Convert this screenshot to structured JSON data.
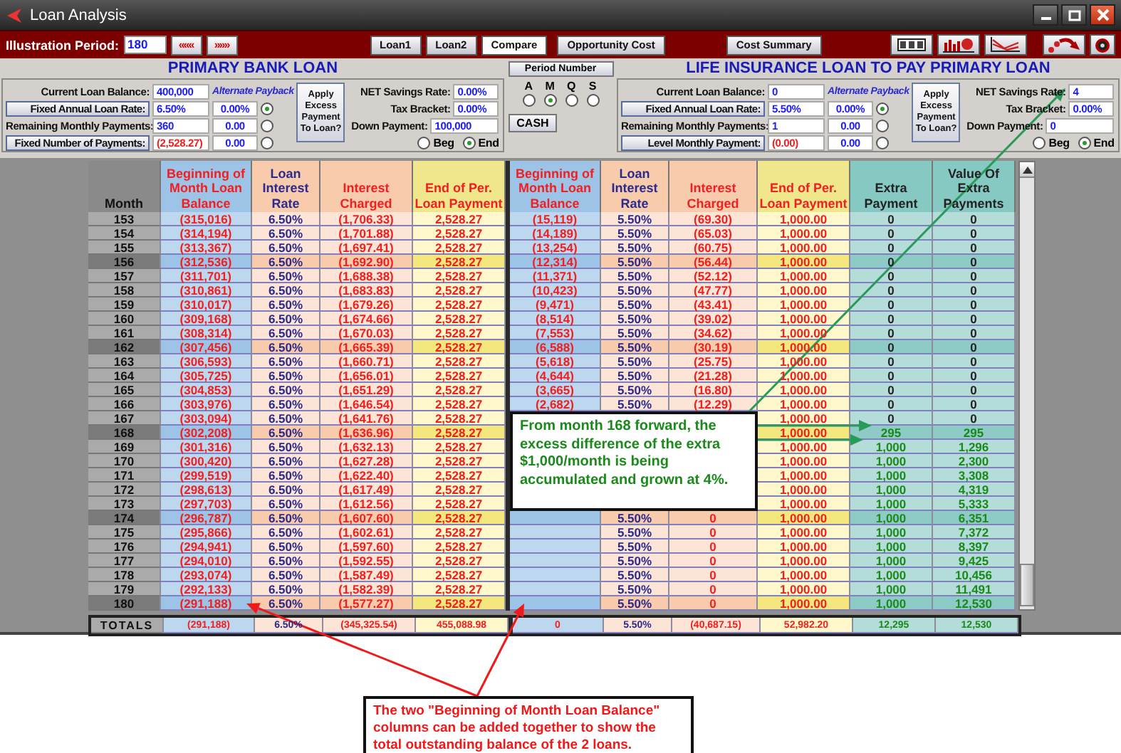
{
  "window": {
    "title": "Loan Analysis"
  },
  "toolbar": {
    "period_label": "Illustration Period:",
    "period_value": "180",
    "nav_buttons": [
      "«««",
      "»»»"
    ],
    "buttons": [
      {
        "label": "Loan1",
        "selected": false
      },
      {
        "label": "Loan2",
        "selected": false
      },
      {
        "label": "Compare",
        "selected": true
      },
      {
        "label": "Opportunity Cost",
        "selected": false
      },
      {
        "label": "Cost Summary",
        "selected": false
      }
    ]
  },
  "panels": [
    {
      "title": "PRIMARY BANK LOAN",
      "balance_label": "Current Loan Balance:",
      "balance_value": "400,000",
      "alt_label": "Alternate Payback",
      "rows": [
        {
          "kind": "button",
          "label": "Fixed Annual Loan Rate:",
          "value": "6.50%",
          "negative": false,
          "alt_value": "0.00%",
          "selected": true
        },
        {
          "kind": "label",
          "label": "Remaining  Monthly Payments:",
          "value": "360",
          "negative": false,
          "alt_value": "0.00",
          "selected": false
        },
        {
          "kind": "button",
          "label": "Fixed Number of Payments:",
          "value": "(2,528.27)",
          "negative": true,
          "alt_value": "0.00",
          "selected": false
        }
      ],
      "apply_label": "Apply Excess Payment To Loan?",
      "fields": [
        {
          "label": "NET Savings Rate:",
          "value": "0.00%"
        },
        {
          "label": "Tax Bracket:",
          "value": "0.00%"
        },
        {
          "label": "Down Payment:",
          "value": "100,000"
        }
      ],
      "timing": [
        {
          "label": "Beg",
          "selected": false
        },
        {
          "label": "End",
          "selected": true
        }
      ]
    },
    {
      "title": "LIFE INSURANCE LOAN TO PAY PRIMARY LOAN",
      "balance_label": "Current Loan Balance:",
      "balance_value": "0",
      "alt_label": "Alternate Payback",
      "rows": [
        {
          "kind": "button",
          "label": "Fixed Annual Loan Rate:",
          "value": "5.50%",
          "negative": false,
          "alt_value": "0.00%",
          "selected": true
        },
        {
          "kind": "label",
          "label": "Remaining  Monthly Payments:",
          "value": "1",
          "negative": false,
          "alt_value": "0.00",
          "selected": false
        },
        {
          "kind": "button",
          "label": "Level Monthly Payment:",
          "value": "(0.00)",
          "negative": true,
          "alt_value": "0.00",
          "selected": false
        }
      ],
      "apply_label": "Apply Excess Payment To Loan?",
      "fields": [
        {
          "label": "NET Savings Rate:",
          "value": "4"
        },
        {
          "label": "Tax Bracket:",
          "value": "0.00%"
        },
        {
          "label": "Down Payment:",
          "value": "0"
        }
      ],
      "timing": [
        {
          "label": "Beg",
          "selected": false
        },
        {
          "label": "End",
          "selected": true
        }
      ]
    }
  ],
  "period": {
    "button": "Period Number",
    "options": [
      {
        "label": "A",
        "selected": false
      },
      {
        "label": "M",
        "selected": true
      },
      {
        "label": "Q",
        "selected": false
      },
      {
        "label": "S",
        "selected": false
      }
    ],
    "cash": "CASH"
  },
  "table": {
    "columns": [
      {
        "label": "Month",
        "kind": "month"
      },
      {
        "label": "Beginning of Month Loan Balance",
        "kind": "balance"
      },
      {
        "label": "Loan Interest Rate",
        "kind": "rate"
      },
      {
        "label": "Interest Charged",
        "kind": "charged"
      },
      {
        "label": "End of Per. Loan Payment",
        "kind": "payment"
      },
      {
        "label": "Beginning of Month Loan Balance",
        "kind": "balance"
      },
      {
        "label": "Loan Interest Rate",
        "kind": "rate"
      },
      {
        "label": "Interest Charged",
        "kind": "charged"
      },
      {
        "label": "End of Per. Loan Payment",
        "kind": "payment"
      },
      {
        "label": "Extra Payment",
        "kind": "extra"
      },
      {
        "label": "Value Of Extra Payments",
        "kind": "extra"
      }
    ],
    "rows": [
      {
        "highlighted": false,
        "extra_active": false,
        "cells": [
          "153",
          "(315,016)",
          "6.50%",
          "(1,706.33)",
          "2,528.27",
          "(15,119)",
          "5.50%",
          "(69.30)",
          "1,000.00",
          "0",
          "0"
        ]
      },
      {
        "highlighted": false,
        "extra_active": false,
        "cells": [
          "154",
          "(314,194)",
          "6.50%",
          "(1,701.88)",
          "2,528.27",
          "(14,189)",
          "5.50%",
          "(65.03)",
          "1,000.00",
          "0",
          "0"
        ]
      },
      {
        "highlighted": false,
        "extra_active": false,
        "cells": [
          "155",
          "(313,367)",
          "6.50%",
          "(1,697.41)",
          "2,528.27",
          "(13,254)",
          "5.50%",
          "(60.75)",
          "1,000.00",
          "0",
          "0"
        ]
      },
      {
        "highlighted": true,
        "extra_active": false,
        "cells": [
          "156",
          "(312,536)",
          "6.50%",
          "(1,692.90)",
          "2,528.27",
          "(12,314)",
          "5.50%",
          "(56.44)",
          "1,000.00",
          "0",
          "0"
        ]
      },
      {
        "highlighted": false,
        "extra_active": false,
        "cells": [
          "157",
          "(311,701)",
          "6.50%",
          "(1,688.38)",
          "2,528.27",
          "(11,371)",
          "5.50%",
          "(52.12)",
          "1,000.00",
          "0",
          "0"
        ]
      },
      {
        "highlighted": false,
        "extra_active": false,
        "cells": [
          "158",
          "(310,861)",
          "6.50%",
          "(1,683.83)",
          "2,528.27",
          "(10,423)",
          "5.50%",
          "(47.77)",
          "1,000.00",
          "0",
          "0"
        ]
      },
      {
        "highlighted": false,
        "extra_active": false,
        "cells": [
          "159",
          "(310,017)",
          "6.50%",
          "(1,679.26)",
          "2,528.27",
          "(9,471)",
          "5.50%",
          "(43.41)",
          "1,000.00",
          "0",
          "0"
        ]
      },
      {
        "highlighted": false,
        "extra_active": false,
        "cells": [
          "160",
          "(309,168)",
          "6.50%",
          "(1,674.66)",
          "2,528.27",
          "(8,514)",
          "5.50%",
          "(39.02)",
          "1,000.00",
          "0",
          "0"
        ]
      },
      {
        "highlighted": false,
        "extra_active": false,
        "cells": [
          "161",
          "(308,314)",
          "6.50%",
          "(1,670.03)",
          "2,528.27",
          "(7,553)",
          "5.50%",
          "(34.62)",
          "1,000.00",
          "0",
          "0"
        ]
      },
      {
        "highlighted": true,
        "extra_active": false,
        "cells": [
          "162",
          "(307,456)",
          "6.50%",
          "(1,665.39)",
          "2,528.27",
          "(6,588)",
          "5.50%",
          "(30.19)",
          "1,000.00",
          "0",
          "0"
        ]
      },
      {
        "highlighted": false,
        "extra_active": false,
        "cells": [
          "163",
          "(306,593)",
          "6.50%",
          "(1,660.71)",
          "2,528.27",
          "(5,618)",
          "5.50%",
          "(25.75)",
          "1,000.00",
          "0",
          "0"
        ]
      },
      {
        "highlighted": false,
        "extra_active": false,
        "cells": [
          "164",
          "(305,725)",
          "6.50%",
          "(1,656.01)",
          "2,528.27",
          "(4,644)",
          "5.50%",
          "(21.28)",
          "1,000.00",
          "0",
          "0"
        ]
      },
      {
        "highlighted": false,
        "extra_active": false,
        "cells": [
          "165",
          "(304,853)",
          "6.50%",
          "(1,651.29)",
          "2,528.27",
          "(3,665)",
          "5.50%",
          "(16.80)",
          "1,000.00",
          "0",
          "0"
        ]
      },
      {
        "highlighted": false,
        "extra_active": false,
        "cells": [
          "166",
          "(303,976)",
          "6.50%",
          "(1,646.54)",
          "2,528.27",
          "(2,682)",
          "5.50%",
          "(12.29)",
          "1,000.00",
          "0",
          "0"
        ]
      },
      {
        "highlighted": false,
        "extra_active": false,
        "cells": [
          "167",
          "(303,094)",
          "6.50%",
          "(1,641.76)",
          "2,528.27",
          null,
          null,
          null,
          "1,000.00",
          "0",
          "0"
        ]
      },
      {
        "highlighted": true,
        "extra_active": true,
        "cells": [
          "168",
          "(302,208)",
          "6.50%",
          "(1,636.96)",
          "2,528.27",
          null,
          null,
          null,
          "1,000.00",
          "295",
          "295"
        ]
      },
      {
        "highlighted": false,
        "extra_active": true,
        "cells": [
          "169",
          "(301,316)",
          "6.50%",
          "(1,632.13)",
          "2,528.27",
          null,
          null,
          null,
          "1,000.00",
          "1,000",
          "1,296"
        ]
      },
      {
        "highlighted": false,
        "extra_active": true,
        "cells": [
          "170",
          "(300,420)",
          "6.50%",
          "(1,627.28)",
          "2,528.27",
          null,
          null,
          null,
          "1,000.00",
          "1,000",
          "2,300"
        ]
      },
      {
        "highlighted": false,
        "extra_active": true,
        "cells": [
          "171",
          "(299,519)",
          "6.50%",
          "(1,622.40)",
          "2,528.27",
          null,
          null,
          null,
          "1,000.00",
          "1,000",
          "3,308"
        ]
      },
      {
        "highlighted": false,
        "extra_active": true,
        "cells": [
          "172",
          "(298,613)",
          "6.50%",
          "(1,617.49)",
          "2,528.27",
          null,
          null,
          null,
          "1,000.00",
          "1,000",
          "4,319"
        ]
      },
      {
        "highlighted": false,
        "extra_active": true,
        "cells": [
          "173",
          "(297,703)",
          "6.50%",
          "(1,612.56)",
          "2,528.27",
          null,
          null,
          null,
          "1,000.00",
          "1,000",
          "5,333"
        ]
      },
      {
        "highlighted": true,
        "extra_active": true,
        "cells": [
          "174",
          "(296,787)",
          "6.50%",
          "(1,607.60)",
          "2,528.27",
          "",
          "5.50%",
          "0",
          "1,000.00",
          "1,000",
          "6,351"
        ]
      },
      {
        "highlighted": false,
        "extra_active": true,
        "cells": [
          "175",
          "(295,866)",
          "6.50%",
          "(1,602.61)",
          "2,528.27",
          "",
          "5.50%",
          "0",
          "1,000.00",
          "1,000",
          "7,372"
        ]
      },
      {
        "highlighted": false,
        "extra_active": true,
        "cells": [
          "176",
          "(294,941)",
          "6.50%",
          "(1,597.60)",
          "2,528.27",
          "",
          "5.50%",
          "0",
          "1,000.00",
          "1,000",
          "8,397"
        ]
      },
      {
        "highlighted": false,
        "extra_active": true,
        "cells": [
          "177",
          "(294,010)",
          "6.50%",
          "(1,592.55)",
          "2,528.27",
          "",
          "5.50%",
          "0",
          "1,000.00",
          "1,000",
          "9,425"
        ]
      },
      {
        "highlighted": false,
        "extra_active": true,
        "cells": [
          "178",
          "(293,074)",
          "6.50%",
          "(1,587.49)",
          "2,528.27",
          "",
          "5.50%",
          "0",
          "1,000.00",
          "1,000",
          "10,456"
        ]
      },
      {
        "highlighted": false,
        "extra_active": true,
        "cells": [
          "179",
          "(292,133)",
          "6.50%",
          "(1,582.39)",
          "2,528.27",
          "",
          "5.50%",
          "0",
          "1,000.00",
          "1,000",
          "11,491"
        ]
      },
      {
        "highlighted": true,
        "extra_active": true,
        "cells": [
          "180",
          "(291,188)",
          "6.50%",
          "(1,577.27)",
          "2,528.27",
          "",
          "5.50%",
          "0",
          "1,000.00",
          "1,000",
          "12,530"
        ]
      }
    ],
    "totals": {
      "cells": [
        "TOTALS",
        "(291,188)",
        "6.50%",
        "(345,325.54)",
        "455,088.98",
        "0",
        "5.50%",
        "(40,687.15)",
        "52,982.20",
        "12,295",
        "12,530"
      ]
    }
  },
  "callouts": [
    {
      "kind": "extra",
      "text": "From month 168 forward, the excess difference of the extra $1,000/month is being accumulated and grown at 4%."
    },
    {
      "kind": "balance",
      "text": "The two \"Beginning of Month Loan Balance\" columns can be added together to show the total outstanding balance of the 2 loans."
    }
  ]
}
